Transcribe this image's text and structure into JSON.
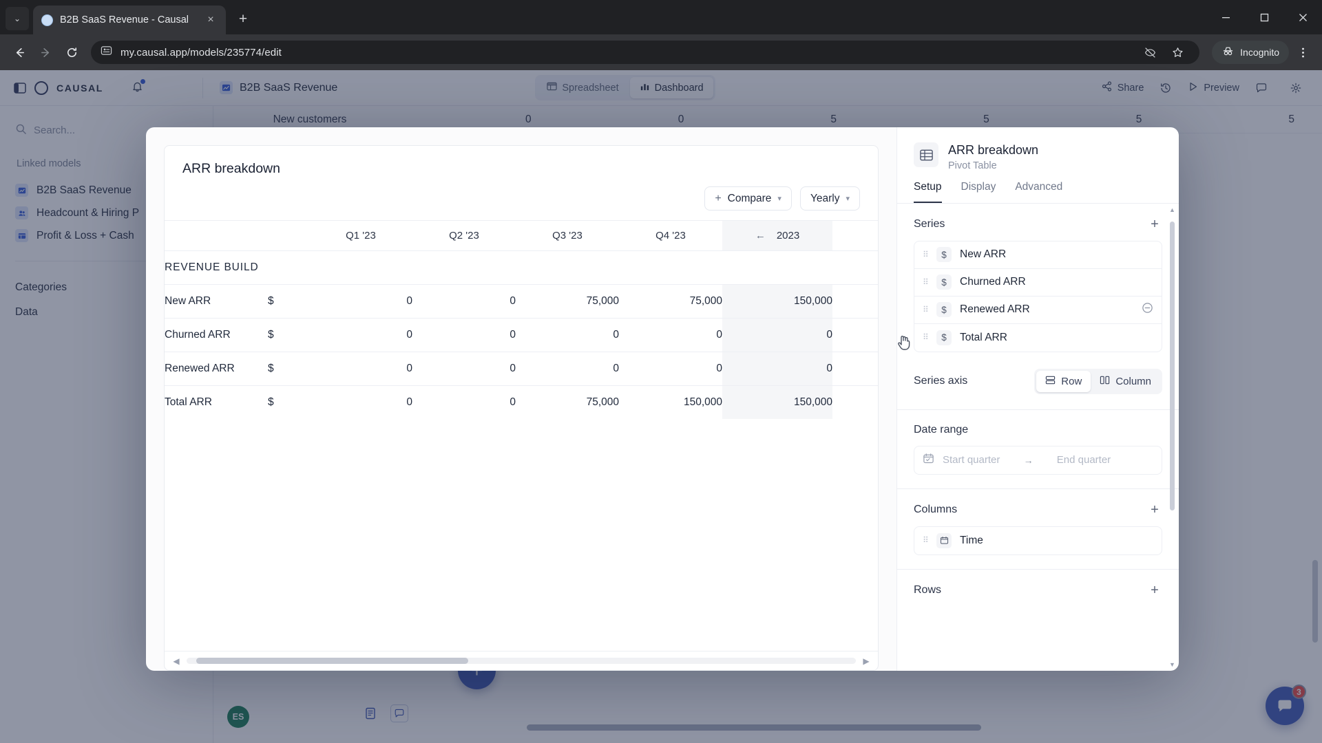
{
  "browser": {
    "tab": {
      "title": "B2B SaaS Revenue - Causal",
      "close_label": "×",
      "favicon": "page-favicon"
    },
    "new_tab_label": "+",
    "tab_list_chevron": "⌄",
    "nav": {
      "back": "←",
      "forward": "→",
      "reload": "↻"
    },
    "omnibox": {
      "url": "my.causal.app/models/235774/edit",
      "site_icon": "site-settings-icon"
    },
    "incognito_label": "Incognito",
    "window": {
      "minimize": "—",
      "maximize": "□",
      "close": "✕"
    }
  },
  "app": {
    "brand": "CAUSAL",
    "doc_title": "B2B SaaS Revenue",
    "view_tabs": [
      {
        "label": "Spreadsheet",
        "icon": "spreadsheet-icon",
        "active": false
      },
      {
        "label": "Dashboard",
        "icon": "dashboard-icon",
        "active": true
      }
    ],
    "header_right": [
      {
        "label": "Share",
        "icon": "share-icon"
      },
      {
        "label": "Preview",
        "icon": "play-icon"
      }
    ],
    "sidebar": {
      "search_placeholder": "Search...",
      "sections": [
        {
          "title": "Linked models",
          "items": [
            {
              "label": "B2B SaaS Revenue",
              "icon": "model-icon"
            },
            {
              "label": "Headcount & Hiring P",
              "icon": "people-icon"
            },
            {
              "label": "Profit & Loss + Cash",
              "icon": "table-icon"
            }
          ]
        }
      ],
      "plain_items": [
        "Categories",
        "Data"
      ]
    },
    "background_sheet": {
      "row_label": "New customers",
      "values": [
        "0",
        "0",
        "5",
        "5",
        "5",
        "5"
      ]
    },
    "add_button_label": "+",
    "user_initials": "ES",
    "chat_badge": "3"
  },
  "modal": {
    "chart": {
      "title": "ARR breakdown",
      "toolbar": {
        "compare_label": "Compare",
        "compare_plus": "+",
        "granularity_label": "Yearly",
        "caret": "▾"
      },
      "section_label": "REVENUE BUILD",
      "scroll": {
        "left_arrow": "◀",
        "right_arrow": "▶"
      }
    },
    "panel": {
      "title": "ARR breakdown",
      "subtitle": "Pivot Table",
      "icon": "pivot-table-icon",
      "tabs": [
        {
          "label": "Setup",
          "active": true
        },
        {
          "label": "Display",
          "active": false
        },
        {
          "label": "Advanced",
          "active": false
        }
      ],
      "series": {
        "title": "Series",
        "add_label": "+",
        "items": [
          {
            "label": "New ARR",
            "type": "$",
            "removable": false
          },
          {
            "label": "Churned ARR",
            "type": "$",
            "removable": false
          },
          {
            "label": "Renewed ARR",
            "type": "$",
            "removable": true
          },
          {
            "label": "Total ARR",
            "type": "$",
            "removable": false
          }
        ]
      },
      "series_axis": {
        "label": "Series axis",
        "options": [
          {
            "label": "Row",
            "icon": "rows-icon",
            "active": true
          },
          {
            "label": "Column",
            "icon": "columns-icon",
            "active": false
          }
        ]
      },
      "date_range": {
        "label": "Date range",
        "start_placeholder": "Start quarter",
        "end_placeholder": "End quarter",
        "arrow": "→",
        "icon": "calendar-icon"
      },
      "columns": {
        "title": "Columns",
        "add_label": "+",
        "items": [
          {
            "label": "Time",
            "icon": "calendar-icon"
          }
        ]
      },
      "rows": {
        "title": "Rows",
        "add_label": "+"
      }
    }
  },
  "chart_data": {
    "type": "table",
    "title": "ARR breakdown",
    "section": "REVENUE BUILD",
    "unit_symbol": "$",
    "columns": [
      "Q1 '23",
      "Q2 '23",
      "Q3 '23",
      "Q4 '23",
      "2023"
    ],
    "year_column_index": 4,
    "year_back_arrow": "←",
    "rows": [
      {
        "name": "New ARR",
        "values": [
          "0",
          "0",
          "75,000",
          "75,000",
          "150,000"
        ]
      },
      {
        "name": "Churned ARR",
        "values": [
          "0",
          "0",
          "0",
          "0",
          "0"
        ]
      },
      {
        "name": "Renewed ARR",
        "values": [
          "0",
          "0",
          "0",
          "0",
          "0"
        ]
      },
      {
        "name": "Total ARR",
        "values": [
          "0",
          "0",
          "75,000",
          "150,000",
          "150,000"
        ]
      }
    ]
  },
  "colors": {
    "accent": "#3a55b4",
    "badge": "#e8433f",
    "avatar": "#137a53",
    "browser_chrome": "#35363a"
  }
}
